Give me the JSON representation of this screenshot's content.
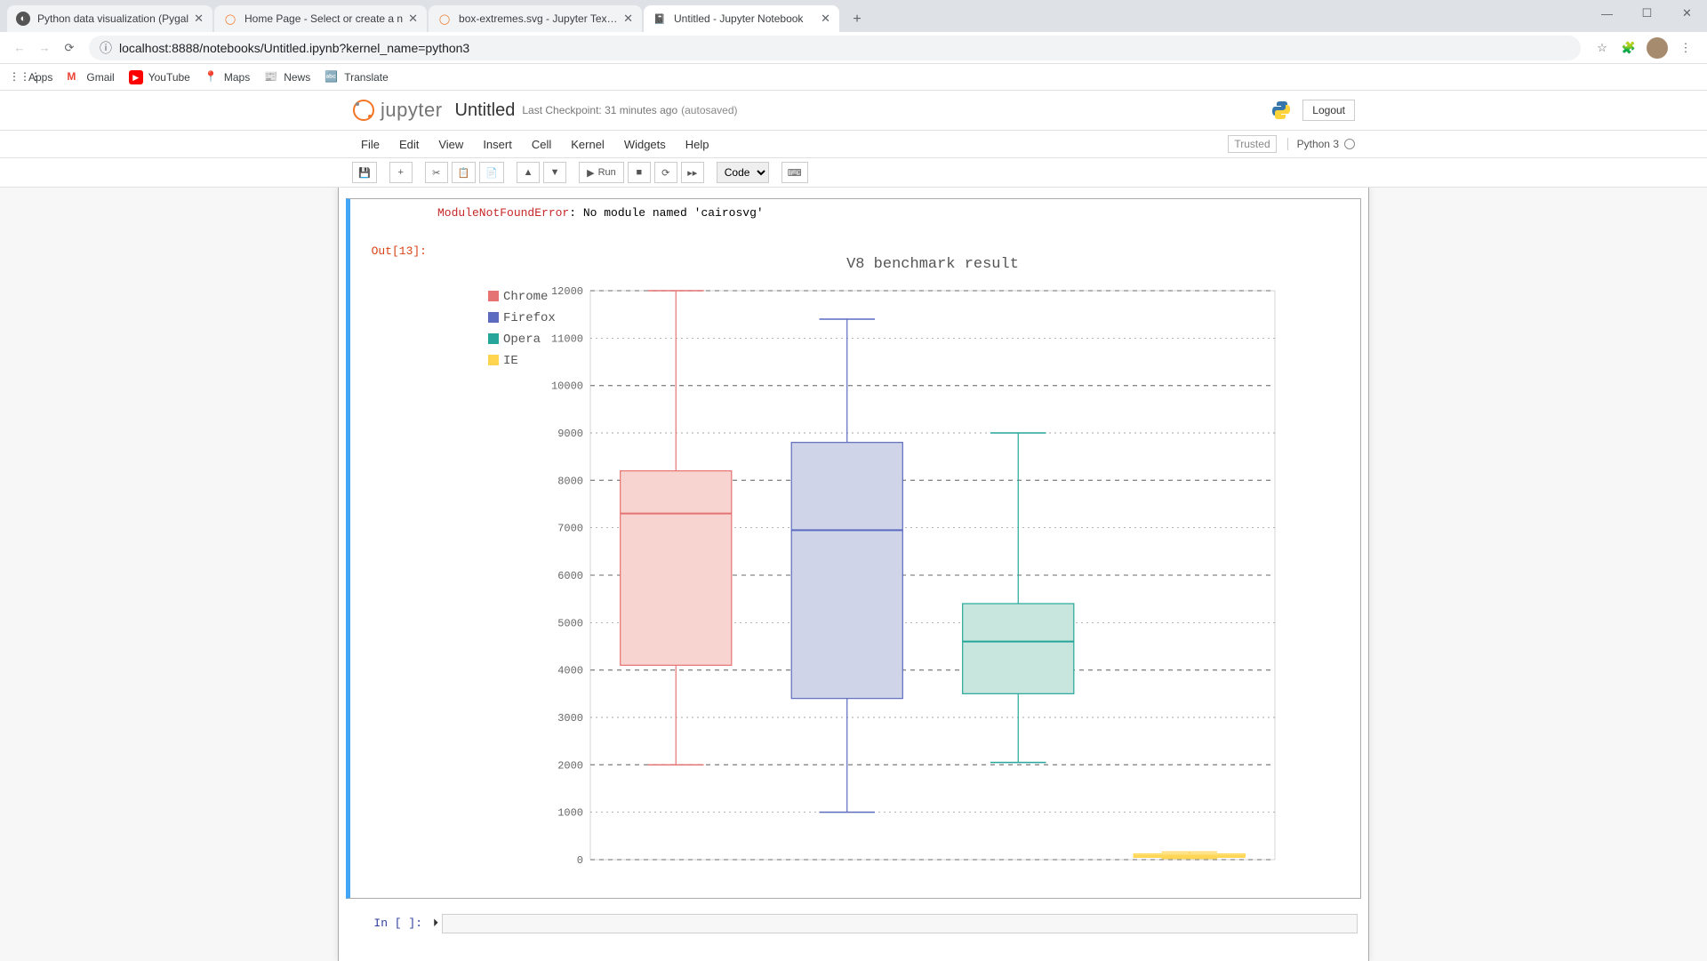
{
  "window": {
    "min": "—",
    "max": "☐",
    "close": "✕"
  },
  "tabs": [
    {
      "title": "Python data visualization (Pygal",
      "fav_bg": "#555",
      "fav_txt": "◐",
      "active": false
    },
    {
      "title": "Home Page - Select or create a n",
      "fav_bg": "#f37626",
      "fav_txt": "◯",
      "active": false
    },
    {
      "title": "box-extremes.svg - Jupyter Text E",
      "fav_bg": "#f37626",
      "fav_txt": "◯",
      "active": false
    },
    {
      "title": "Untitled - Jupyter Notebook",
      "fav_bg": "#f37626",
      "fav_txt": "📓",
      "active": true
    }
  ],
  "url": "localhost:8888/notebooks/Untitled.ipynb?kernel_name=python3",
  "bookmarks": [
    {
      "label": "Apps",
      "color": "#5f6368",
      "glyph": "⋮⋮⋮"
    },
    {
      "label": "Gmail",
      "color": "#ea4335",
      "glyph": "M"
    },
    {
      "label": "YouTube",
      "color": "#ff0000",
      "glyph": "▶"
    },
    {
      "label": "Maps",
      "color": "#34a853",
      "glyph": "📍"
    },
    {
      "label": "News",
      "color": "#4285f4",
      "glyph": "📰"
    },
    {
      "label": "Translate",
      "color": "#4285f4",
      "glyph": "🔤"
    }
  ],
  "jupyter": {
    "logo": "jupyter",
    "title": "Untitled",
    "checkpoint": "Last Checkpoint: 31 minutes ago",
    "autosave": "(autosaved)",
    "logout": "Logout",
    "menus": [
      "File",
      "Edit",
      "View",
      "Insert",
      "Cell",
      "Kernel",
      "Widgets",
      "Help"
    ],
    "trusted": "Trusted",
    "kernel": "Python 3",
    "toolbar": {
      "save": "💾",
      "add": "+",
      "cut": "✂",
      "copy": "📋",
      "paste": "📄",
      "up": "▲",
      "down": "▼",
      "run_icon": "▶",
      "run": "Run",
      "stop": "■",
      "restart": "⟳",
      "ff": "▸▸",
      "cmd": "⌨",
      "type": "Code"
    }
  },
  "error": {
    "name": "ModuleNotFoundError",
    "msg": ": No module named 'cairosvg'"
  },
  "out_prompt": "Out[13]:",
  "in_prompt": "In [ ]:",
  "chart_data": {
    "type": "boxplot",
    "title": "V8 benchmark result",
    "ylim": [
      0,
      12000
    ],
    "yticks": [
      0,
      1000,
      2000,
      3000,
      4000,
      5000,
      6000,
      7000,
      8000,
      9000,
      10000,
      11000,
      12000
    ],
    "series": [
      {
        "name": "Chrome",
        "color": "#e57373",
        "fill": "#f8d4d0",
        "min": 2000,
        "q1": 4100,
        "median": 7300,
        "q3": 8200,
        "max": 12000
      },
      {
        "name": "Firefox",
        "color": "#5c6bc0",
        "fill": "#d0d4e8",
        "min": 1000,
        "q1": 3400,
        "median": 6950,
        "q3": 8800,
        "max": 11400
      },
      {
        "name": "Opera",
        "color": "#26a69a",
        "fill": "#c8e6de",
        "min": 2050,
        "q1": 3500,
        "median": 4600,
        "q3": 5400,
        "max": 9000
      },
      {
        "name": "IE",
        "color": "#ffd54f",
        "fill": "#fff0b3",
        "min": 25,
        "q1": 50,
        "median": 80,
        "q3": 120,
        "max": 160
      }
    ]
  }
}
